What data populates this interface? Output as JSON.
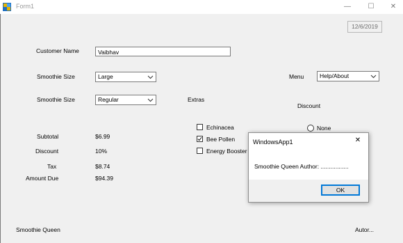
{
  "window": {
    "title": "Form1",
    "minimize_glyph": "—",
    "maximize_glyph": "☐",
    "close_glyph": "✕"
  },
  "date": "12/6/2019",
  "customer": {
    "label": "Customer Name",
    "value": "Vaibhav"
  },
  "smoothie_size": {
    "label": "Smoothie Size",
    "value": "Large"
  },
  "smoothie_type": {
    "label": "Smoothie Size",
    "value": "Regular"
  },
  "menu": {
    "label": "Menu",
    "value": "Help/About"
  },
  "extras": {
    "label": "Extras",
    "items": [
      {
        "label": "Echinacea",
        "checked": false
      },
      {
        "label": "Bee Pollen",
        "checked": true
      },
      {
        "label": "Energy Booster",
        "checked": false
      }
    ]
  },
  "discount_group": {
    "label": "Discount",
    "options": [
      {
        "label": "None",
        "checked": false
      }
    ]
  },
  "totals": [
    {
      "label": "Subtotal",
      "value": "$6.99"
    },
    {
      "label": "Discount",
      "value": "10%"
    },
    {
      "label": "Tax",
      "value": "$8.74"
    },
    {
      "label": "Amount Due",
      "value": "$94.39"
    }
  ],
  "footer": {
    "left": "Smoothie Queen",
    "right": "Autor..."
  },
  "dialog": {
    "title": "WindowsApp1",
    "message": "Smoothie Queen  Author: .................",
    "ok_label": "OK",
    "close_glyph": "✕"
  },
  "colors": {
    "accent": "#0078d7",
    "background": "#f0f0f0"
  }
}
